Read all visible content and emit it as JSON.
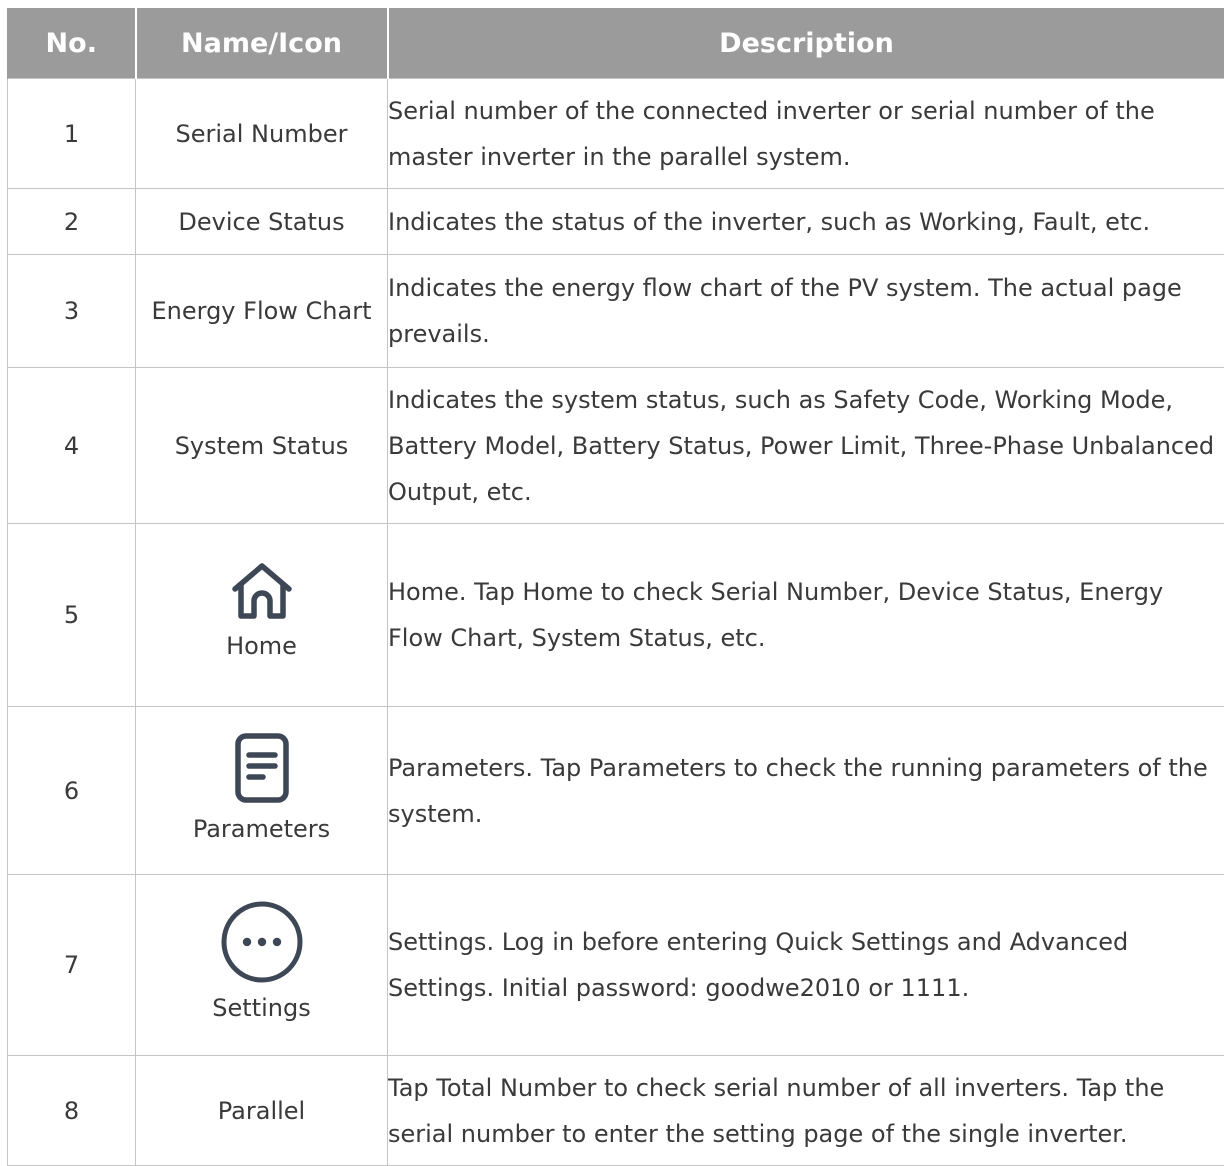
{
  "table": {
    "headers": {
      "no": "No.",
      "name": "Name/Icon",
      "description": "Description"
    },
    "rows": [
      {
        "no": "1",
        "name": "Serial Number",
        "icon": "",
        "description": "Serial number of the connected inverter or serial number of the master inverter in the parallel system."
      },
      {
        "no": "2",
        "name": "Device Status",
        "icon": "",
        "description": "Indicates the status of the inverter, such as Working, Fault, etc."
      },
      {
        "no": "3",
        "name": "Energy Flow Chart",
        "icon": "",
        "description": "Indicates the energy flow chart of the PV system. The actual page prevails."
      },
      {
        "no": "4",
        "name": "System Status",
        "icon": "",
        "description": "Indicates the system status, such as Safety Code, Working Mode, Battery Model, Battery Status, Power Limit, Three-Phase Unbalanced Output, etc."
      },
      {
        "no": "5",
        "name": "Home",
        "icon": "home-icon",
        "description": "Home. Tap Home to check Serial Number, Device Status, Energy Flow Chart, System Status, etc."
      },
      {
        "no": "6",
        "name": "Parameters",
        "icon": "document-icon",
        "description": "Parameters. Tap Parameters to check the running parameters of the system."
      },
      {
        "no": "7",
        "name": "Settings",
        "icon": "more-dots-icon",
        "description": "Settings. Log in before entering Quick Settings and Advanced Settings. Initial password: goodwe2010 or 1111."
      },
      {
        "no": "8",
        "name": "Parallel",
        "icon": "",
        "description": "Tap Total Number to check serial number of all inverters. Tap the serial number to enter the setting page of the single inverter."
      }
    ]
  },
  "colors": {
    "header_bg": "#9b9b9b",
    "header_text": "#ffffff",
    "border": "#c4c4c4",
    "text": "#3a3a3a",
    "icon_stroke": "#3d4756"
  }
}
